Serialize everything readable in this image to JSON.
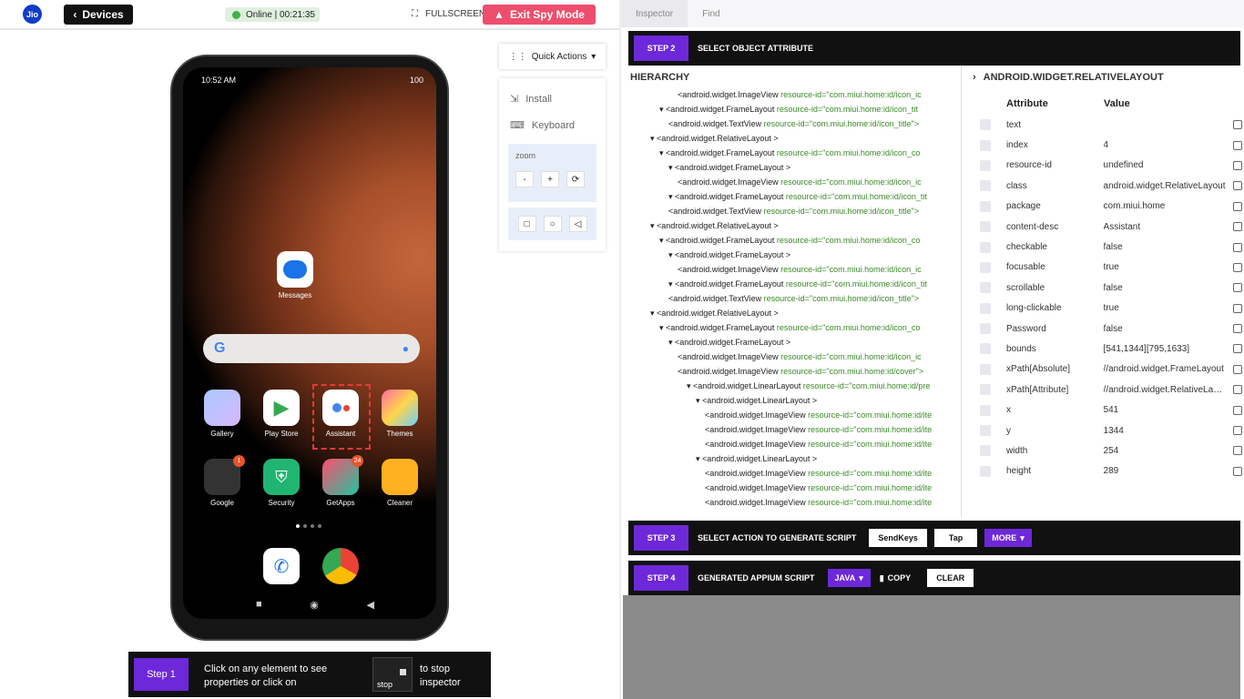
{
  "header": {
    "logo": "Jio",
    "devices_label": "Devices",
    "status": "Online | 00:21:35",
    "fullscreen_label": "FULLSCREEN",
    "exit_label": "Exit Spy Mode"
  },
  "phone": {
    "time": "10:52 AM",
    "battery": "100",
    "apps": {
      "messages": "Messages",
      "gallery": "Gallery",
      "playstore": "Play Store",
      "assistant": "Assistant",
      "themes": "Themes",
      "google": "Google",
      "security": "Security",
      "getapps": "GetApps",
      "cleaner": "Cleaner"
    },
    "badges": {
      "google": "1",
      "getapps": "24"
    }
  },
  "quick_actions": {
    "label": "Quick Actions",
    "install": "Install",
    "keyboard": "Keyboard",
    "zoom": "zoom",
    "minus": "-",
    "plus": "+"
  },
  "step1": {
    "label": "Step 1",
    "text": "Click on any element to see properties or click on",
    "stop": "stop",
    "text2": "to stop inspector"
  },
  "tabs": [
    "Inspector",
    "Find"
  ],
  "step2": {
    "label": "STEP 2",
    "title": "SELECT OBJECT ATTRIBUTE"
  },
  "hierarchy": {
    "title": "HIERARCHY",
    "lines": [
      {
        "t": "<android.widget.ImageView ",
        "g": "resource-id=\"com.miui.home:id/icon_ic"
      },
      {
        "t": "▾ <android.widget.FrameLayout ",
        "g": "resource-id=\"com.miui.home:id/icon_tit"
      },
      {
        "t": "<android.widget.TextView ",
        "g": "resource-id=\"com.miui.home:id/icon_title\">"
      },
      {
        "t": "▾ <android.widget.RelativeLayout >",
        "g": ""
      },
      {
        "t": "▾ <android.widget.FrameLayout ",
        "g": "resource-id=\"com.miui.home:id/icon_co"
      },
      {
        "t": "▾ <android.widget.FrameLayout >",
        "g": ""
      },
      {
        "t": "<android.widget.ImageView ",
        "g": "resource-id=\"com.miui.home:id/icon_ic"
      },
      {
        "t": "▾ <android.widget.FrameLayout ",
        "g": "resource-id=\"com.miui.home:id/icon_tit"
      },
      {
        "t": "<android.widget.TextView ",
        "g": "resource-id=\"com.miui.home:id/icon_title\">"
      },
      {
        "t": "▾ <android.widget.RelativeLayout >",
        "g": ""
      },
      {
        "t": "▾ <android.widget.FrameLayout ",
        "g": "resource-id=\"com.miui.home:id/icon_co"
      },
      {
        "t": "▾ <android.widget.FrameLayout >",
        "g": ""
      },
      {
        "t": "<android.widget.ImageView ",
        "g": "resource-id=\"com.miui.home:id/icon_ic"
      },
      {
        "t": "▾ <android.widget.FrameLayout ",
        "g": "resource-id=\"com.miui.home:id/icon_tit"
      },
      {
        "t": "<android.widget.TextView ",
        "g": "resource-id=\"com.miui.home:id/icon_title\">"
      },
      {
        "t": "▾ <android.widget.RelativeLayout >",
        "g": ""
      },
      {
        "t": "▾ <android.widget.FrameLayout ",
        "g": "resource-id=\"com.miui.home:id/icon_co"
      },
      {
        "t": "▾ <android.widget.FrameLayout >",
        "g": ""
      },
      {
        "t": "<android.widget.ImageView ",
        "g": "resource-id=\"com.miui.home:id/icon_ic"
      },
      {
        "t": "<android.widget.ImageView ",
        "g": "resource-id=\"com.miui.home:id/cover\">"
      },
      {
        "t": "▾ <android.widget.LinearLayout ",
        "g": "resource-id=\"com.miui.home:id/pre"
      },
      {
        "t": "▾ <android.widget.LinearLayout >",
        "g": ""
      },
      {
        "t": "<android.widget.ImageView ",
        "g": "resource-id=\"com.miui.home:id/ite"
      },
      {
        "t": "<android.widget.ImageView ",
        "g": "resource-id=\"com.miui.home:id/ite"
      },
      {
        "t": "<android.widget.ImageView ",
        "g": "resource-id=\"com.miui.home:id/ite"
      },
      {
        "t": "▾ <android.widget.LinearLayout >",
        "g": ""
      },
      {
        "t": "<android.widget.ImageView ",
        "g": "resource-id=\"com.miui.home:id/ite"
      },
      {
        "t": "<android.widget.ImageView ",
        "g": "resource-id=\"com.miui.home:id/ite"
      },
      {
        "t": "<android.widget.ImageView ",
        "g": "resource-id=\"com.miui.home:id/ite"
      }
    ]
  },
  "attributes": {
    "title": "ANDROID.WIDGET.RELATIVELAYOUT",
    "col_attr": "Attribute",
    "col_val": "Value",
    "rows": [
      [
        "text",
        ""
      ],
      [
        "index",
        "4"
      ],
      [
        "resource-id",
        "undefined"
      ],
      [
        "class",
        "android.widget.RelativeLayout"
      ],
      [
        "package",
        "com.miui.home"
      ],
      [
        "content-desc",
        "Assistant"
      ],
      [
        "checkable",
        "false"
      ],
      [
        "focusable",
        "true"
      ],
      [
        "scrollable",
        "false"
      ],
      [
        "long-clickable",
        "true"
      ],
      [
        "Password",
        "false"
      ],
      [
        "bounds",
        "[541,1344][795,1633]"
      ],
      [
        "xPath[Absolute]",
        "//android.widget.FrameLayout"
      ],
      [
        "xPath[Attribute]",
        "//android.widget.RelativeLayout"
      ],
      [
        "x",
        "541"
      ],
      [
        "y",
        "1344"
      ],
      [
        "width",
        "254"
      ],
      [
        "height",
        "289"
      ]
    ]
  },
  "step3": {
    "label": "STEP 3",
    "title": "SELECT ACTION TO GENERATE SCRIPT",
    "sendkeys": "SendKeys",
    "tap": "Tap",
    "more": "MORE"
  },
  "step4": {
    "label": "STEP 4",
    "title": "GENERATED APPIUM SCRIPT",
    "lang": "JAVA",
    "copy": "COPY",
    "clear": "CLEAR"
  }
}
